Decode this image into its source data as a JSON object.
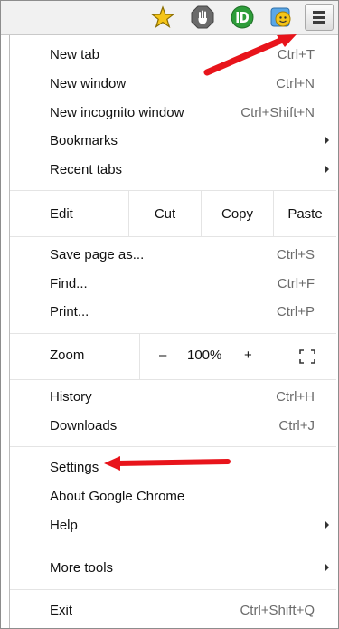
{
  "toolbar": {
    "icons": [
      "star-icon",
      "adblock-hand-icon",
      "green-d-extension-icon",
      "emoji-extension-icon",
      "hamburger-menu-icon"
    ]
  },
  "menu": {
    "new_tab": {
      "label": "New tab",
      "shortcut": "Ctrl+T"
    },
    "new_window": {
      "label": "New window",
      "shortcut": "Ctrl+N"
    },
    "new_incognito": {
      "label": "New incognito window",
      "shortcut": "Ctrl+Shift+N"
    },
    "bookmarks": {
      "label": "Bookmarks"
    },
    "recent_tabs": {
      "label": "Recent tabs"
    },
    "edit": {
      "label": "Edit",
      "cut": "Cut",
      "copy": "Copy",
      "paste": "Paste"
    },
    "save_page": {
      "label": "Save page as...",
      "shortcut": "Ctrl+S"
    },
    "find": {
      "label": "Find...",
      "shortcut": "Ctrl+F"
    },
    "print": {
      "label": "Print...",
      "shortcut": "Ctrl+P"
    },
    "zoom": {
      "label": "Zoom",
      "minus": "–",
      "value": "100%",
      "plus": "+"
    },
    "history": {
      "label": "History",
      "shortcut": "Ctrl+H"
    },
    "downloads": {
      "label": "Downloads",
      "shortcut": "Ctrl+J"
    },
    "settings": {
      "label": "Settings"
    },
    "about": {
      "label": "About Google Chrome"
    },
    "help": {
      "label": "Help"
    },
    "more_tools": {
      "label": "More tools"
    },
    "exit": {
      "label": "Exit",
      "shortcut": "Ctrl+Shift+Q"
    }
  },
  "colors": {
    "annotation_red": "#e8141b",
    "star_yellow": "#f5c518",
    "green_badge": "#2e9d3a"
  }
}
